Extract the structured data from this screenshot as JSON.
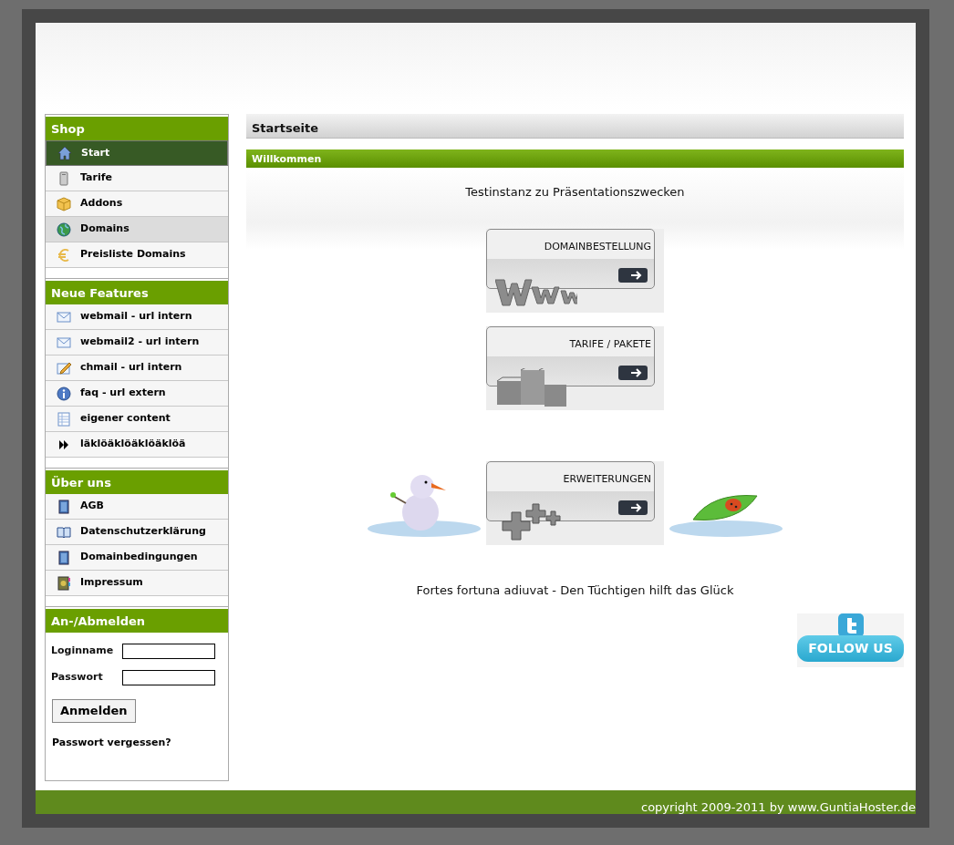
{
  "sidebar": {
    "sections": [
      {
        "title": "Shop",
        "items": [
          {
            "label": "Start",
            "selected": true,
            "highlighted": false
          },
          {
            "label": "Tarife",
            "selected": false,
            "highlighted": false
          },
          {
            "label": "Addons",
            "selected": false,
            "highlighted": false
          },
          {
            "label": "Domains",
            "selected": false,
            "highlighted": true
          },
          {
            "label": "Preisliste Domains",
            "selected": false,
            "highlighted": false
          }
        ]
      },
      {
        "title": "Neue Features",
        "items": [
          {
            "label": "webmail - url intern",
            "selected": false,
            "highlighted": false
          },
          {
            "label": "webmail2 - url intern",
            "selected": false,
            "highlighted": false
          },
          {
            "label": "chmail - url intern",
            "selected": false,
            "highlighted": false
          },
          {
            "label": "faq - url extern",
            "selected": false,
            "highlighted": false
          },
          {
            "label": "eigener content",
            "selected": false,
            "highlighted": false
          },
          {
            "label": "läklöäklöäklöäklöä",
            "selected": false,
            "highlighted": false
          }
        ]
      },
      {
        "title": "Über uns",
        "items": [
          {
            "label": "AGB",
            "selected": false,
            "highlighted": false
          },
          {
            "label": "Datenschutzerklärung",
            "selected": false,
            "highlighted": false
          },
          {
            "label": "Domainbedingungen",
            "selected": false,
            "highlighted": false
          },
          {
            "label": "Impressum",
            "selected": false,
            "highlighted": false
          }
        ]
      }
    ],
    "login": {
      "title": "An-/Abmelden",
      "fields": [
        {
          "label": "Loginname"
        },
        {
          "label": "Passwort"
        }
      ],
      "button": "Anmelden",
      "forgot_link": "Passwort vergessen?"
    }
  },
  "main": {
    "page_title": "Startseite",
    "panel_title": "Willkommen",
    "intro": "Testinstanz zu Präsentationszwecken",
    "banners": [
      {
        "label": "DOMAINBESTELLUNG",
        "kind": "www"
      },
      {
        "label": "TARIFE / PAKETE",
        "kind": "boxes"
      },
      {
        "label": "ERWEITERUNGEN",
        "kind": "plus"
      }
    ],
    "quote": "Fortes fortuna adiuvat - Den Tüchtigen hilft das Glück",
    "follow_button": "FOLLOW US"
  },
  "footer": {
    "copyright": "copyright 2009-2011 by www.GuntiaHoster.de"
  }
}
